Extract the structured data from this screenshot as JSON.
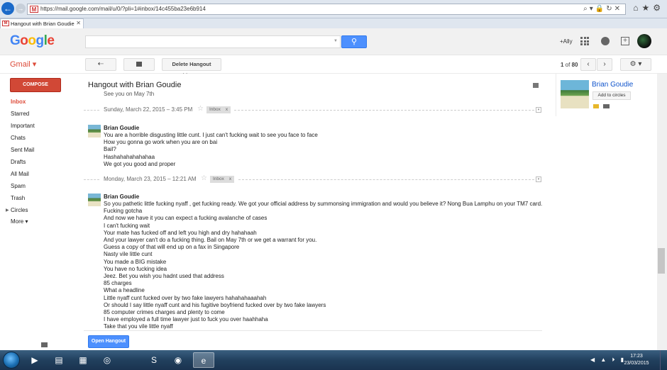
{
  "browser": {
    "url": "https://mail.google.com/mail/u/0/?pli=1#inbox/14c455ba23e6b914",
    "tab_title": "Hangout with Brian Goudie",
    "tab_close": "✕"
  },
  "header": {
    "logo_letters": [
      "G",
      "o",
      "o",
      "g",
      "l",
      "e"
    ],
    "plus_user": "+Ally"
  },
  "toolbar": {
    "gmail_label": "Gmail ▾",
    "reply_icon": "⇠",
    "delete_history_label": "Delete Hangout history",
    "pager_current": "1",
    "pager_of": " of ",
    "pager_total": "80",
    "prev_icon": "‹",
    "next_icon": "›",
    "settings_icon": "⚙ ▾"
  },
  "sidebar": {
    "compose_label": "COMPOSE",
    "items": [
      {
        "label": "Inbox"
      },
      {
        "label": "Starred"
      },
      {
        "label": "Important"
      },
      {
        "label": "Chats"
      },
      {
        "label": "Sent Mail"
      },
      {
        "label": "Drafts"
      },
      {
        "label": "All Mail"
      },
      {
        "label": "Spam"
      },
      {
        "label": "Trash"
      },
      {
        "label": "Circles"
      },
      {
        "label": "More ▾"
      }
    ]
  },
  "conversation": {
    "title": "Hangout with Brian Goudie",
    "previous_line": "See you on May 7th",
    "inbox_chip": "Inbox",
    "chip_close": "x",
    "star": "☆",
    "sep_menu": "▾",
    "groups": [
      {
        "date": "Sunday, March 22, 2015  – 3:45 PM",
        "from": "Brian Goudie",
        "lines": [
          "You are a horrible disgusting little cunt. I just can't fucking wait to see you face to face",
          "How you gonna go work when you are on bai",
          "Bail?",
          "Hashahahahahahaa",
          "We got you good and proper"
        ]
      },
      {
        "date": "Monday, March 23, 2015  – 12:21 AM",
        "from": "Brian Goudie",
        "lines": [
          "So you pathetic little fucking nyaff , get fucking ready. We got your official address by summonsing immigration and would you believe it? Nong Bua Lamphu on your TM7 card.",
          "Fucking gotcha",
          "And now we have it you can expect a fucking avalanche of cases",
          "I can't fucking wait",
          "Your mate has fucked off and left you high and dry hahahaah",
          "And your lawyer can't do a fucking thing. Bail on May 7th or we get a warrant for you.",
          "Guess a copy of that will end up on a fax in Singapore",
          "Nasty vile little cunt",
          "You made a BIG mistake",
          "You have no fucking idea",
          "Jeez. Bet you wish you hadnt used that address",
          "85 charges",
          "What a headline",
          "Little nyaff cunt fucked over by two fake lawyers hahahahaaahah",
          "Or should I say little nyaff cunt and his fugitive boyfriend fucked over by two fake lawyers",
          "85 computer crimes charges and plenty to come",
          "I have employed a full time lawyer just to fuck you over haahhaha",
          "Take that you vile little nyaff"
        ]
      }
    ],
    "open_hangout_label": "Open Hangout"
  },
  "contact": {
    "name": "Brian Goudie",
    "add_to_circles": "Add to circles"
  },
  "taskbar": {
    "apps": [
      {
        "name": "media-player",
        "glyph": "▶"
      },
      {
        "name": "file-explorer",
        "glyph": "▤"
      },
      {
        "name": "calculator",
        "glyph": "▦"
      },
      {
        "name": "network-app",
        "glyph": "◎"
      },
      {
        "name": "skype",
        "glyph": "S"
      },
      {
        "name": "camera-app",
        "glyph": "◉"
      },
      {
        "name": "internet-explorer",
        "glyph": "e"
      }
    ],
    "tray": "◀ ▲ ⏵ ▮",
    "time": "17:23",
    "date": "23/03/2015"
  },
  "colors": {
    "accent_red": "#d14836",
    "link_blue": "#1155cc",
    "button_blue": "#4d90fe"
  }
}
